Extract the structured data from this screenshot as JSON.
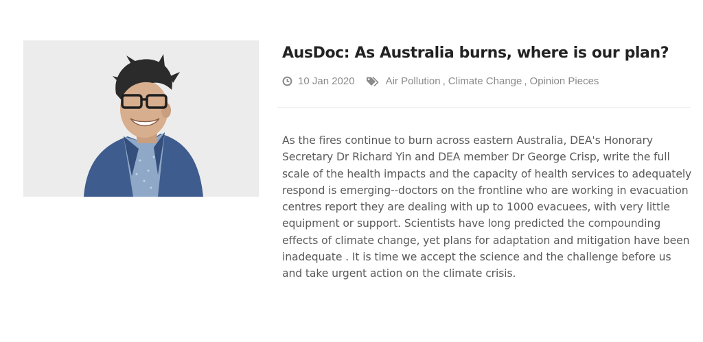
{
  "post": {
    "title": "AusDoc: As Australia burns, where is our plan?",
    "date": "10 Jan 2020",
    "categories": [
      "Air Pollution",
      "Climate Change",
      "Opinion Pieces"
    ],
    "separator": ",",
    "excerpt": "As the fires continue to burn across eastern Australia, DEA's Honorary Secretary Dr Richard Yin and DEA member Dr George Crisp, write the full scale of the health impacts and the capacity of health services to adequately respond is emerging--doctors on the frontline who are working in evacuation centres report they are dealing with up to 1000 evacuees, with very little equipment or support. Scientists have long predicted the compounding effects of climate change, yet plans for adaptation and mitigation have been inadequate . It is time we accept the science and the challenge before us and take urgent action on the climate crisis.",
    "thumbnail_icon": "portrait-photo",
    "meta_icons": {
      "date": "clock-icon",
      "categories": "tag-icon"
    }
  },
  "colors": {
    "title": "#222222",
    "meta": "#8a8a8a",
    "body_text": "#5a5a5a",
    "divider": "#ececec",
    "photo_background": "#ebebeb",
    "jacket": "#3f5c8e",
    "shirt": "#8fa8c8"
  }
}
